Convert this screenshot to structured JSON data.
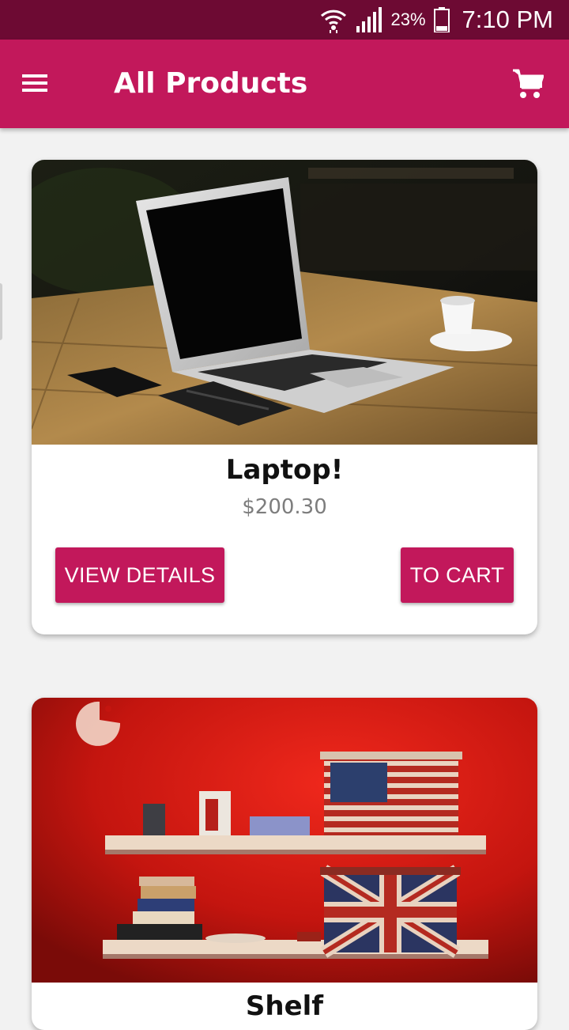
{
  "status_bar": {
    "battery_percent": "23%",
    "time": "7:10 PM",
    "icons": [
      "wifi-icon",
      "signal-icon",
      "battery-icon"
    ]
  },
  "app_bar": {
    "title": "All Products",
    "menu_icon": "hamburger-menu-icon",
    "cart_icon": "shopping-cart-icon"
  },
  "products": [
    {
      "name": "Laptop!",
      "price": "$200.30",
      "image": "laptop-on-wooden-table-photo",
      "view_details_label": "VIEW DETAILS",
      "to_cart_label": "TO CART"
    },
    {
      "name": "Shelf",
      "image": "red-wall-shelf-photo"
    }
  ],
  "colors": {
    "status_bar": "#6d0a33",
    "primary": "#c2185b",
    "background": "#f2f2f2",
    "price_text": "#7d7d7d"
  }
}
